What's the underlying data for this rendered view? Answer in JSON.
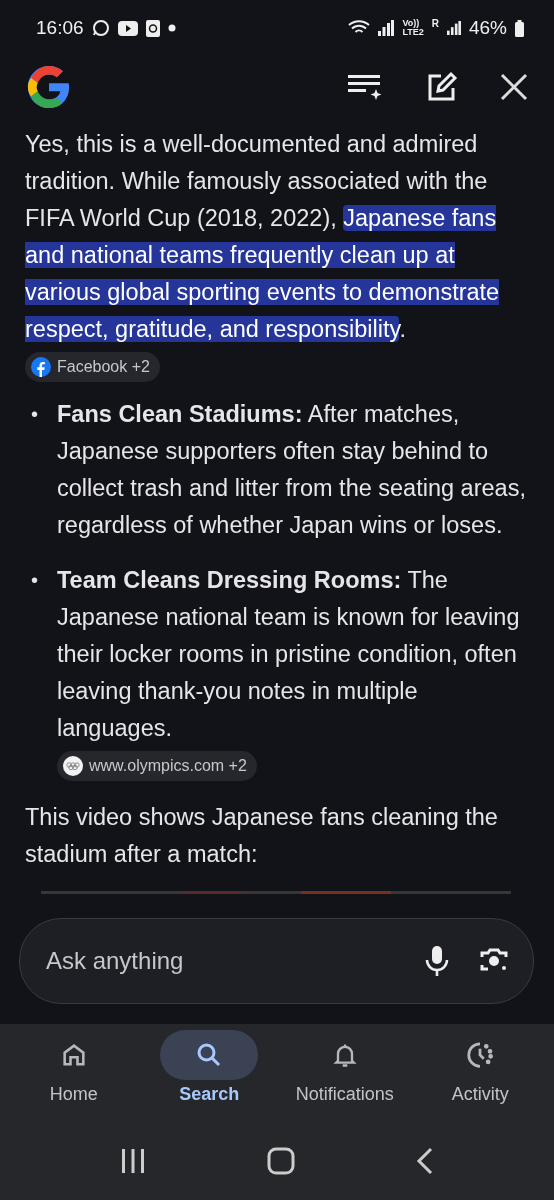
{
  "status_bar": {
    "time": "16:06",
    "network_label": "Vo))",
    "network_sub": "LTE2",
    "roaming": "R",
    "battery": "46%"
  },
  "answer": {
    "intro": [
      {
        "text": "Yes, this is a well-documented and admired tradition. While famously associated with the FIFA World Cup (2018, 2022), ",
        "highlighted": false
      },
      {
        "text": "Japanese fans and national teams frequently clean up at various global sporting events to demonstrate respect, gratitude, and responsibility",
        "highlighted": true
      },
      {
        "text": ".",
        "highlighted": false
      }
    ],
    "intro_source": {
      "label": "Facebook +2",
      "kind": "facebook"
    },
    "bullets": [
      {
        "marker": "•",
        "text": "**Fans Clean Stadiums:** After matches, Japanese supporters often stay behind to collect trash and litter from the seating areas, regardless of whether Japan wins or loses."
      },
      {
        "marker": "•",
        "text": "**Team Cleans Dressing Rooms:** The Japanese national team is known for leaving their locker rooms in pristine condition, often leaving thank-you notes in multiple languages.",
        "source": {
          "label": "www.olympics.com +2",
          "kind": "olympics"
        }
      }
    ],
    "video_caption": "This video shows Japanese fans cleaning the stadium after a match:"
  },
  "search": {
    "placeholder": "Ask anything"
  },
  "bottom_nav": [
    {
      "label": "Home",
      "selected": false
    },
    {
      "label": "Search",
      "selected": true
    },
    {
      "label": "Notifications",
      "selected": false
    },
    {
      "label": "Activity",
      "selected": false
    }
  ]
}
